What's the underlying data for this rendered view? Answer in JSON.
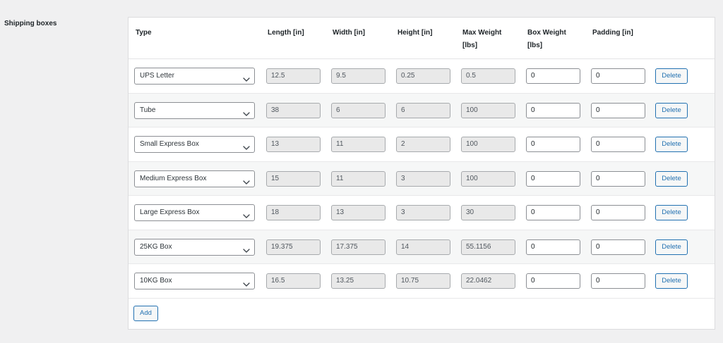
{
  "section_label": "Shipping boxes",
  "headers": {
    "type": "Type",
    "length": "Length [in]",
    "width": "Width [in]",
    "height": "Height [in]",
    "max_weight_1": "Max Weight",
    "max_weight_2": "[lbs]",
    "box_weight_1": "Box Weight",
    "box_weight_2": "[lbs]",
    "padding": "Padding [in]"
  },
  "rows": [
    {
      "type": "UPS Letter",
      "length": "12.5",
      "width": "9.5",
      "height": "0.25",
      "max_weight": "0.5",
      "box_weight": "0",
      "padding": "0"
    },
    {
      "type": "Tube",
      "length": "38",
      "width": "6",
      "height": "6",
      "max_weight": "100",
      "box_weight": "0",
      "padding": "0"
    },
    {
      "type": "Small Express Box",
      "length": "13",
      "width": "11",
      "height": "2",
      "max_weight": "100",
      "box_weight": "0",
      "padding": "0"
    },
    {
      "type": "Medium Express Box",
      "length": "15",
      "width": "11",
      "height": "3",
      "max_weight": "100",
      "box_weight": "0",
      "padding": "0"
    },
    {
      "type": "Large Express Box",
      "length": "18",
      "width": "13",
      "height": "3",
      "max_weight": "30",
      "box_weight": "0",
      "padding": "0"
    },
    {
      "type": "25KG Box",
      "length": "19.375",
      "width": "17.375",
      "height": "14",
      "max_weight": "55.1156",
      "box_weight": "0",
      "padding": "0"
    },
    {
      "type": "10KG Box",
      "length": "16.5",
      "width": "13.25",
      "height": "10.75",
      "max_weight": "22.0462",
      "box_weight": "0",
      "padding": "0"
    }
  ],
  "buttons": {
    "delete": "Delete",
    "add": "Add"
  },
  "icons": {
    "select_arrow": "chevron-down-icon"
  }
}
